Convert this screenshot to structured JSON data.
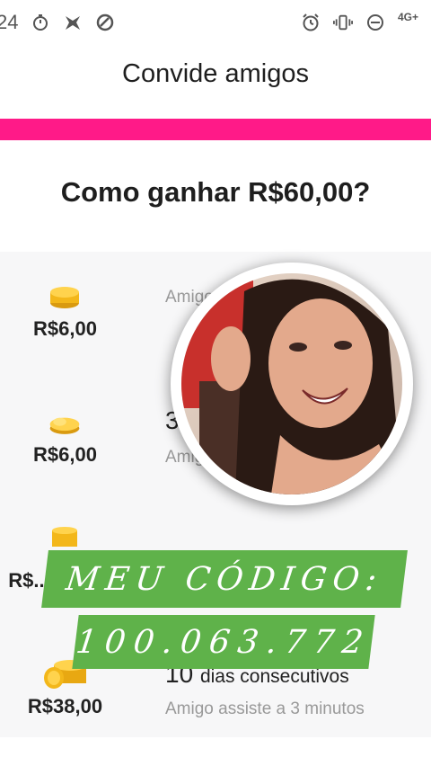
{
  "status": {
    "time": "24",
    "network": "4G+"
  },
  "header": {
    "title": "Convide amigos"
  },
  "main": {
    "subtitle": "Como ganhar R$60,00?",
    "rows": [
      {
        "amount": "R$6,00",
        "title_visible": "",
        "title_suffix": "",
        "desc": "Amigo ... de co..."
      },
      {
        "amount": "R$6,00",
        "title_visible": "3",
        "title_suffix": "",
        "desc": "Amig... s"
      },
      {
        "amount": "R$...",
        "title_visible": "",
        "title_suffix": "",
        "desc": ""
      },
      {
        "amount": "R$38,00",
        "title_visible": "10",
        "title_suffix": "dias consecutivos",
        "desc": "Amigo assiste a 3 minutos"
      }
    ]
  },
  "overlay": {
    "banner_line1": "MEU CÓDIGO:",
    "banner_line2": "100.063.772"
  },
  "colors": {
    "accent": "#ff1a88",
    "banner": "#5fb24a",
    "coin": "#f3b71a"
  }
}
